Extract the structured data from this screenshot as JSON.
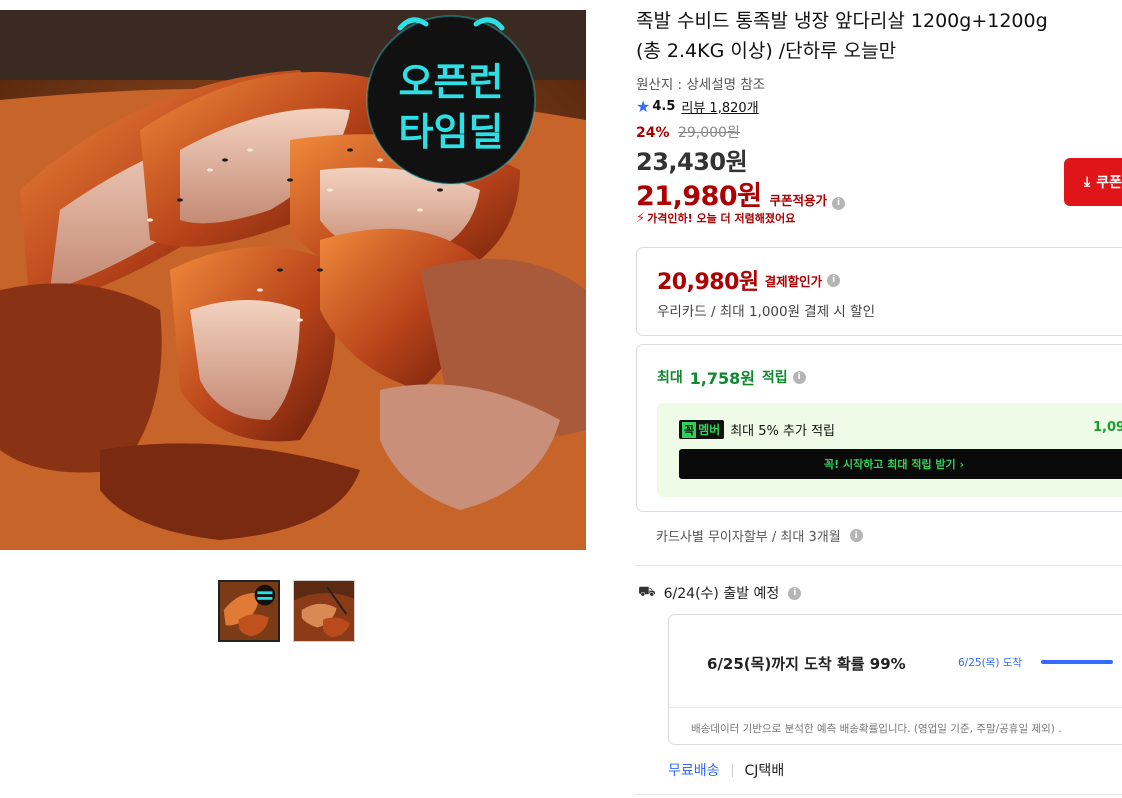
{
  "product": {
    "title_line1": "족발 수비드 통족발 냉장 앞다리살 1200g+1200g",
    "title_line2": "(총 2.4KG 이상) /단하루 오늘만",
    "origin": "원산지 : 상세설명 참조",
    "rating": "4.5",
    "review_label": "리뷰 1,820개"
  },
  "promo_badge": {
    "line1": "오픈런",
    "line2": "타임딜",
    "color": "#2de0e6"
  },
  "pricing": {
    "discount_pct": "24%",
    "original_price": "29,000원",
    "sale_price": "23,430원",
    "coupon_price": "21,980원",
    "coupon_label": "쿠폰적용가",
    "price_drop_note": "가격인하! 오늘 더 저렴해졌어요",
    "accent_red": "#ae0000"
  },
  "coupon_button": {
    "label": "쿠폰",
    "color": "#e0151a"
  },
  "card_discount": {
    "price": "20,980원",
    "label": "결제할인가",
    "desc": "우리카드 / 최대 1,000원 결제 시 할인"
  },
  "reward": {
    "prefix": "최대",
    "amount": "1,758원",
    "suffix": "적립",
    "member_badge_k": "꼭",
    "member_badge_text": "멤버",
    "member_desc": "최대 5% 추가 적립",
    "member_points": "1,09",
    "member_button": "꼭! 시작하고 최대 적립 받기  ›"
  },
  "installment": "카드사별 무이자할부 / 최대 3개월",
  "shipping": {
    "depart": "6/24(수) 출발 예정",
    "arrival_main": "6/25(목)까지 도착 확률 99%",
    "arrival_tag": "6/25(목) 도착",
    "arrival_probability": 0.99,
    "note": "배송데이터 기반으로 분석한 예측 배송확률입니다. (영업일 기준, 주말/공휴일 제외) .",
    "free_label": "무료배송",
    "courier": "CJ택배"
  },
  "icons": {
    "star": "star-icon",
    "info": "info-icon",
    "truck": "truck-icon",
    "download": "download-icon",
    "price-drop": "price-drop-icon"
  }
}
